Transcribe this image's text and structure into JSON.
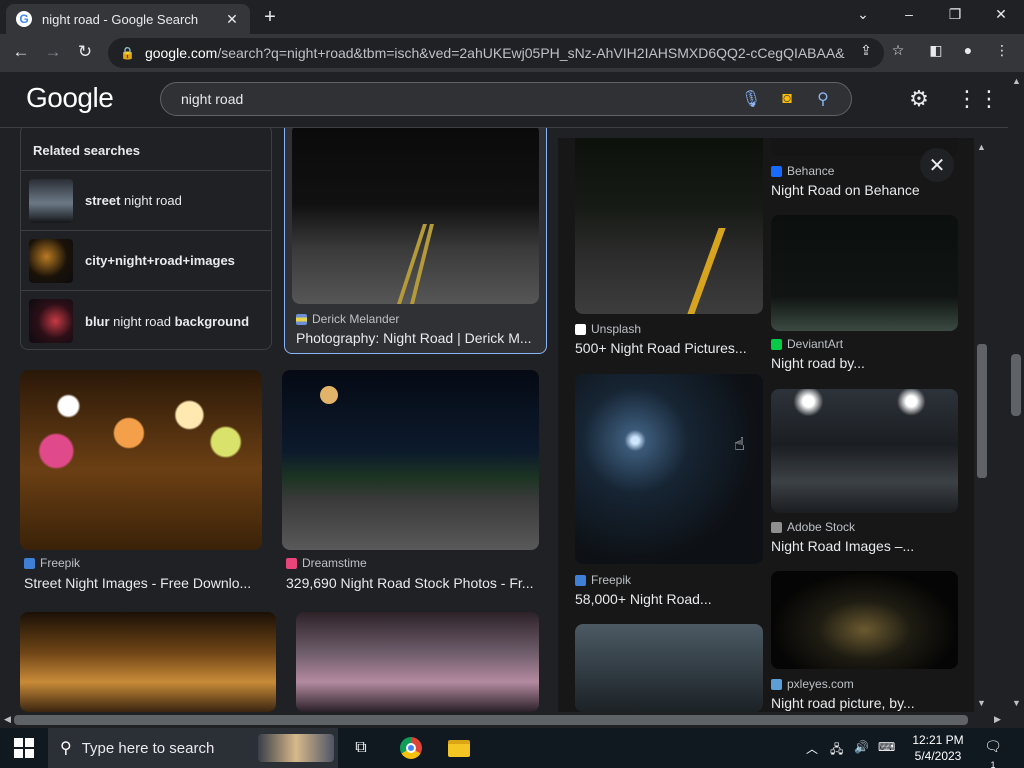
{
  "browser": {
    "tab_title": "night road - Google Search",
    "new_tab": "+",
    "url_host": "google.com",
    "url_rest": "/search?q=night+road&tbm=isch&ved=2ahUKEwj05PH_sNz-AhVIH2IAHSMXD6QQ2-cCegQIABAA&...",
    "window_controls": [
      "minimize",
      "maximize",
      "close"
    ]
  },
  "google": {
    "logo": "Google",
    "query": "night road"
  },
  "related": {
    "heading": "Related searches",
    "items": [
      {
        "bold": "street",
        "rest": " night road",
        "colors": [
          "#2a2e35",
          "#6c7a86",
          "#141619"
        ]
      },
      {
        "bold": "city+night+road+images",
        "rest": "",
        "colors": [
          "#1a1208",
          "#b97a22",
          "#0b0b0d"
        ]
      },
      {
        "bold": "blur",
        "rest": " night road ",
        "bold2": "background",
        "colors": [
          "#2d0f17",
          "#c73a44",
          "#0b0b10"
        ]
      }
    ]
  },
  "results": {
    "col1": [
      {
        "source": "Derick Melander",
        "caption": "Photography: Night Road | Derick M...",
        "fav": "#6b8fd6",
        "selected": true
      },
      {
        "source": "Freepik",
        "caption": "Street Night Images - Free Downlo...",
        "fav": "#3f7fd6"
      },
      {
        "source": "Dreamstime",
        "caption": "329,690 Night Road Stock Photos - Fr...",
        "fav": "#e8457a"
      }
    ],
    "col2": [
      {
        "source": "Unsplash",
        "caption": "500+ Night Road Pictures...",
        "fav": "#ffffff"
      },
      {
        "source": "Freepik",
        "caption": "58,000+ Night Road...",
        "fav": "#3f7fd6"
      }
    ],
    "col3": [
      {
        "source": "Behance",
        "caption": "Night Road on Behance",
        "fav": "#1769ff",
        "fav_text": "Be"
      },
      {
        "source": "DeviantArt",
        "caption": "Night road by...",
        "fav": "#05cc47"
      },
      {
        "source": "Adobe Stock",
        "caption": "Night Road Images –...",
        "fav": "#8f8f8f"
      },
      {
        "source": "pxleyes.com",
        "caption": "Night road picture, by...",
        "fav": "#5c9fd6"
      }
    ]
  },
  "taskbar": {
    "search_placeholder": "Type here to search",
    "time": "12:21 PM",
    "date": "5/4/2023",
    "notification_count": "1"
  }
}
